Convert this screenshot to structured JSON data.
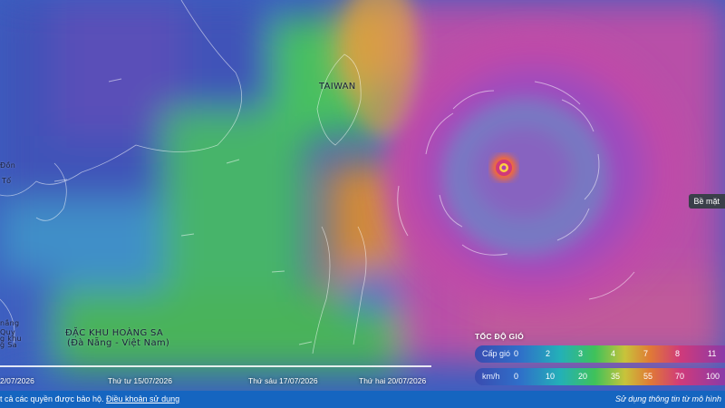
{
  "map": {
    "labels": {
      "taiwan": "TAIWAN",
      "hoang_sa_line1": "ĐẶC KHU HOÀNG SA",
      "hoang_sa_line2": "(Đà Nẵng - Việt Nam)",
      "left_fragment_1": "Đồn",
      "left_fragment_2": "Tố",
      "left_fragment_3": "nắng",
      "left_fragment_4": "Quy",
      "left_fragment_5": "g khu",
      "left_fragment_6": "g Sa"
    },
    "surface_tag": "Bề mặt",
    "colors": {
      "storm_magenta": "#b040b0",
      "eye_ring": "#ff5a2a",
      "ocean_green": "#3fb35a",
      "ocean_blue": "#3a56c0"
    }
  },
  "timeline": {
    "dates": [
      "2/07/2026",
      "Thứ tư 15/07/2026",
      "Thứ sáu 17/07/2026",
      "Thứ hai 20/07/2026"
    ]
  },
  "legend": {
    "title": "TỐC ĐỘ GIÓ",
    "row1_label": "Cấp gió",
    "row1_values": [
      "0",
      "2",
      "3",
      "4",
      "7",
      "8",
      "11"
    ],
    "row2_label": "km/h",
    "row2_values": [
      "0",
      "10",
      "20",
      "35",
      "55",
      "70",
      "100"
    ]
  },
  "footer": {
    "rights_text": "t cả các quyền được bảo hộ.",
    "terms_link": "Điều khoản sử dụng",
    "source_text": "Sử dụng thông tin từ mô hình"
  }
}
